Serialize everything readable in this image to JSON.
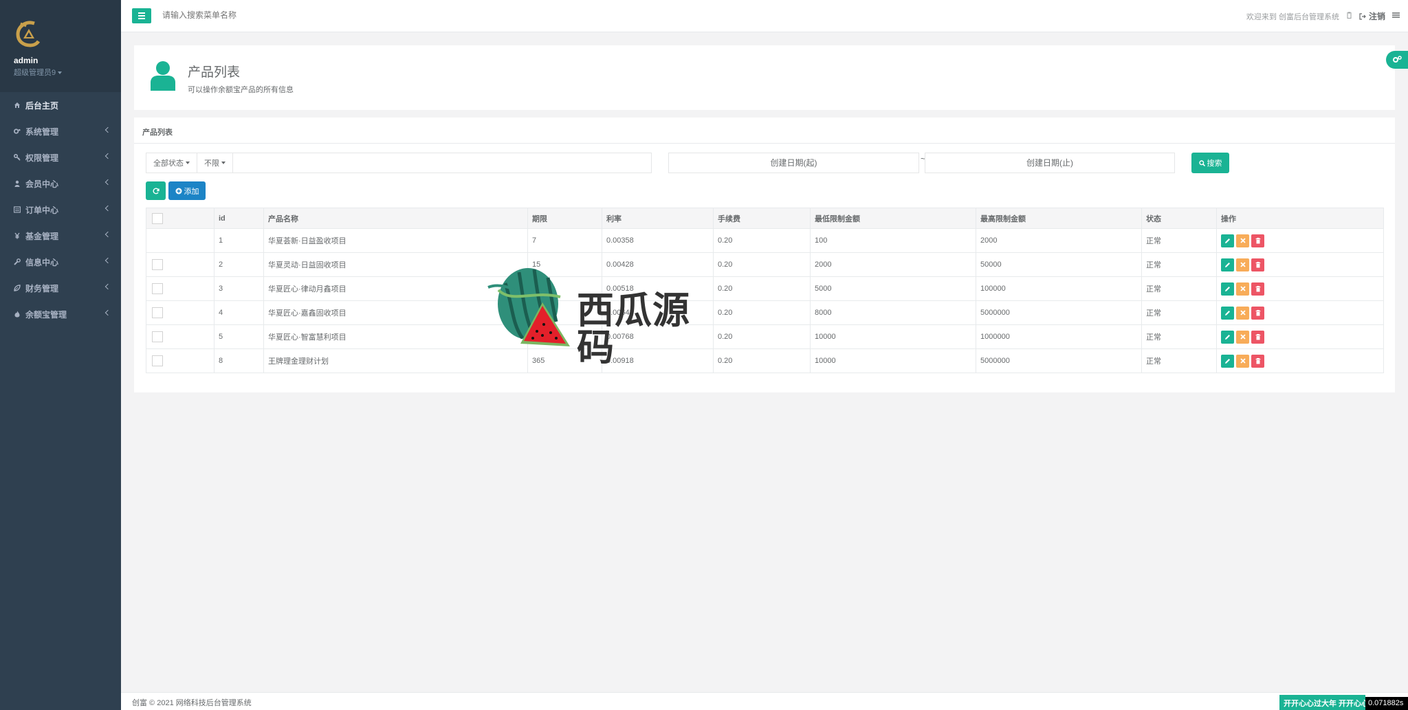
{
  "sidebar": {
    "user_name": "admin",
    "user_role": "超级管理员9",
    "items": [
      {
        "label": "后台主页",
        "icon": "home-icon"
      },
      {
        "label": "系统管理",
        "icon": "cogs-icon"
      },
      {
        "label": "权限管理",
        "icon": "key-icon"
      },
      {
        "label": "会员中心",
        "icon": "user-icon"
      },
      {
        "label": "订单中心",
        "icon": "list-icon"
      },
      {
        "label": "基金管理",
        "icon": "yen-icon"
      },
      {
        "label": "信息中心",
        "icon": "wrench-icon"
      },
      {
        "label": "财务管理",
        "icon": "leaf-icon"
      },
      {
        "label": "余额宝管理",
        "icon": "fire-icon"
      }
    ]
  },
  "topbar": {
    "search_placeholder": "请输入搜索菜单名称",
    "welcome": "欢迎来到 创富后台管理系统",
    "logout": "注销"
  },
  "page": {
    "title": "产品列表",
    "subtitle": "可以操作余额宝产品的所有信息"
  },
  "panel": {
    "title": "产品列表",
    "status_filter": "全部状态",
    "range_filter": "不限",
    "date_start": "创建日期(起)",
    "date_sep": "~",
    "date_end": "创建日期(止)",
    "search_label": "搜索",
    "add_label": "添加"
  },
  "table": {
    "headers": [
      "id",
      "产品名称",
      "期限",
      "利率",
      "手续费",
      "最低限制金额",
      "最高限制金额",
      "状态",
      "操作"
    ],
    "rows": [
      {
        "id": "1",
        "name": "华夏荟新·日益盈收项目",
        "term": "7",
        "rate": "0.00358",
        "fee": "0.20",
        "min": "100",
        "max": "2000",
        "status": "正常",
        "checkbox": false
      },
      {
        "id": "2",
        "name": "华夏灵动·日益固收项目",
        "term": "15",
        "rate": "0.00428",
        "fee": "0.20",
        "min": "2000",
        "max": "50000",
        "status": "正常",
        "checkbox": true
      },
      {
        "id": "3",
        "name": "华夏匠心·律动月鑫项目",
        "term": "30",
        "rate": "0.00518",
        "fee": "0.20",
        "min": "5000",
        "max": "100000",
        "status": "正常",
        "checkbox": true
      },
      {
        "id": "4",
        "name": "华夏匠心·嘉鑫固收项目",
        "term": "",
        "rate": "0.00648",
        "fee": "0.20",
        "min": "8000",
        "max": "5000000",
        "status": "正常",
        "checkbox": true
      },
      {
        "id": "5",
        "name": "华夏匠心·智富慧利项目",
        "term": "",
        "rate": "0.00768",
        "fee": "0.20",
        "min": "10000",
        "max": "1000000",
        "status": "正常",
        "checkbox": true
      },
      {
        "id": "8",
        "name": "王牌理金理财计划",
        "term": "365",
        "rate": "0.00918",
        "fee": "0.20",
        "min": "10000",
        "max": "5000000",
        "status": "正常",
        "checkbox": true
      }
    ]
  },
  "watermark": {
    "text": "西瓜源码"
  },
  "footer": {
    "copyright": "创富 © 2021 网络科技后台管理系统",
    "badge": "开开心心过大年 开开心心",
    "timer": "0.071882s"
  },
  "colors": {
    "primary": "#1ab394",
    "info": "#1c84c6",
    "warning": "#f8ac59",
    "danger": "#ed5565",
    "sidebar": "#2f4050"
  }
}
